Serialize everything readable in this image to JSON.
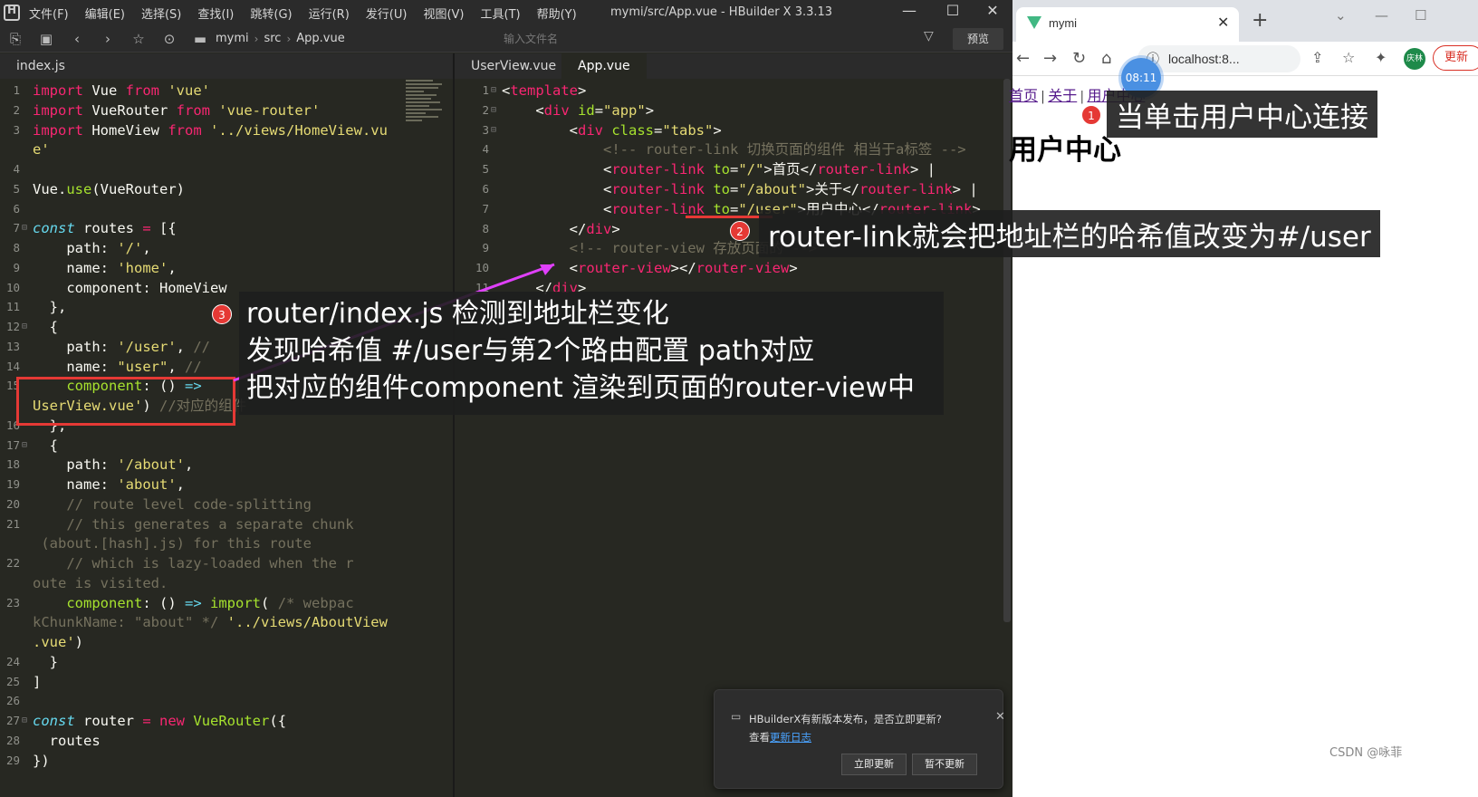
{
  "hbuilder": {
    "menu": [
      "文件(F)",
      "编辑(E)",
      "选择(S)",
      "查找(I)",
      "跳转(G)",
      "运行(R)",
      "发行(U)",
      "视图(V)",
      "工具(T)",
      "帮助(Y)"
    ],
    "title": "mymi/src/App.vue - HBuilder X 3.3.13",
    "breadcrumb": [
      "mymi",
      "src",
      "App.vue"
    ],
    "file_input_placeholder": "输入文件名",
    "preview_label": "预览",
    "left_tab": "index.js",
    "right_tabs": [
      "UserView.vue",
      "App.vue"
    ]
  },
  "left_code": [
    {
      "n": "1",
      "html": "<span class='kw'>import</span> Vue <span class='kw'>from</span> <span class='st'>'vue'</span>"
    },
    {
      "n": "2",
      "html": "<span class='kw'>import</span> VueRouter <span class='kw'>from</span> <span class='st'>'vue-router'</span>"
    },
    {
      "n": "3",
      "html": "<span class='kw'>import</span> HomeView <span class='kw'>from</span> <span class='st'>'../views/HomeView.vu</span>"
    },
    {
      "n": "",
      "html": "<span class='st'>e'</span>"
    },
    {
      "n": "4",
      "html": ""
    },
    {
      "n": "5",
      "html": "Vue.<span class='fn'>use</span>(VueRouter)"
    },
    {
      "n": "6",
      "html": ""
    },
    {
      "n": "7",
      "fold": true,
      "html": "<span class='it'>const</span> routes <span class='kw'>=</span> [{"
    },
    {
      "n": "8",
      "html": "    path: <span class='st'>'/'</span>,"
    },
    {
      "n": "9",
      "html": "    name: <span class='st'>'home'</span>,"
    },
    {
      "n": "10",
      "html": "    component: HomeView"
    },
    {
      "n": "11",
      "html": "  },"
    },
    {
      "n": "12",
      "fold": true,
      "html": "  {"
    },
    {
      "n": "13",
      "html": "    path: <span class='st'>'/user'</span>, <span class='cm'>//</span>"
    },
    {
      "n": "14",
      "html": "    name: <span class='st'>\"user\"</span>, <span class='cm'>//</span>"
    },
    {
      "n": "15",
      "html": "    <span class='fn'>component</span>: () <span class='it'>=&gt;</span>"
    },
    {
      "n": "",
      "html": "<span class='st'>UserView.vue'</span>) <span class='cm'>//对应的组件</span>"
    },
    {
      "n": "16",
      "html": "  },"
    },
    {
      "n": "17",
      "fold": true,
      "html": "  {"
    },
    {
      "n": "18",
      "html": "    path: <span class='st'>'/about'</span>,"
    },
    {
      "n": "19",
      "html": "    name: <span class='st'>'about'</span>,"
    },
    {
      "n": "20",
      "html": "    <span class='cm'>// route level code-splitting</span>"
    },
    {
      "n": "21",
      "html": "    <span class='cm'>// this generates a separate chunk</span>"
    },
    {
      "n": "",
      "html": "<span class='cm'> (about.[hash].js) for this route</span>"
    },
    {
      "n": "22",
      "html": "    <span class='cm'>// which is lazy-loaded when the r</span>"
    },
    {
      "n": "",
      "html": "<span class='cm'>oute is visited.</span>"
    },
    {
      "n": "23",
      "html": "    <span class='fn'>component</span>: () <span class='it'>=&gt;</span> <span class='fn'>import</span>( <span class='cm'>/* webpac</span>"
    },
    {
      "n": "",
      "html": "<span class='cm'>kChunkName: \"about\" */</span> <span class='st'>'../views/AboutView</span>"
    },
    {
      "n": "",
      "html": "<span class='st'>.vue'</span>)"
    },
    {
      "n": "24",
      "html": "  }"
    },
    {
      "n": "25",
      "html": "]"
    },
    {
      "n": "26",
      "html": ""
    },
    {
      "n": "27",
      "fold": true,
      "html": "<span class='it'>const</span> router <span class='kw'>=</span> <span class='kw'>new</span> <span class='fn'>VueRouter</span>({"
    },
    {
      "n": "28",
      "html": "  routes"
    },
    {
      "n": "29",
      "html": "})"
    }
  ],
  "right_code": [
    {
      "n": "1",
      "fold": true,
      "html": "<span class='tx'>&lt;</span><span class='tg'>template</span><span class='tx'>&gt;</span>"
    },
    {
      "n": "2",
      "fold": true,
      "html": "    &lt;<span class='tg'>div</span> <span class='at'>id</span>=<span class='st'>\"app\"</span>&gt;"
    },
    {
      "n": "3",
      "fold": true,
      "html": "        &lt;<span class='tg'>div</span> <span class='at'>class</span>=<span class='st'>\"tabs\"</span>&gt;"
    },
    {
      "n": "4",
      "html": "            <span class='cm'>&lt;!-- router-link 切换页面的组件 相当于a标签 --&gt;</span>"
    },
    {
      "n": "5",
      "html": "            &lt;<span class='tg'>router-link</span> <span class='at'>to</span>=<span class='st'>\"/\"</span>&gt;首页&lt;/<span class='tg'>router-link</span>&gt; |"
    },
    {
      "n": "6",
      "html": "            &lt;<span class='tg'>router-link</span> <span class='at'>to</span>=<span class='st'>\"/about\"</span>&gt;关于&lt;/<span class='tg'>router-link</span>&gt; |"
    },
    {
      "n": "7",
      "html": "            &lt;<span class='tg'>router-link</span> <span class='at'>to</span>=<span class='st'>\"/user\"</span>&gt;用户中心&lt;/<span class='tg'>router-link</span>&gt;"
    },
    {
      "n": "8",
      "html": "        &lt;/<span class='tg'>div</span>&gt;"
    },
    {
      "n": "9",
      "html": "        <span class='cm'>&lt;!-- router-view 存放页面的 --&gt;</span>"
    },
    {
      "n": "10",
      "html": "        &lt;<span class='tg'>router-view</span>&gt;&lt;/<span class='tg'>router-view</span>&gt;"
    },
    {
      "n": "11",
      "html": "    &lt;/<span class='tg'>div</span>&gt;"
    }
  ],
  "notification": {
    "message": "HBuilderX有新版本发布，是否立即更新?",
    "log_prefix": "查看",
    "log_link": "更新日志",
    "update_now": "立即更新",
    "later": "暂不更新"
  },
  "browser": {
    "tab_title": "mymi",
    "url": "localhost:8...",
    "avatar": "庆林",
    "update_label": "更新",
    "timer": "08:11",
    "nav_links": [
      "首页",
      "关于",
      "用户中心"
    ],
    "page_heading": "用户中心"
  },
  "annotations": {
    "badge1": "1",
    "badge2": "2",
    "badge3": "3",
    "note1": "当单击用户中心连接",
    "note2": "router-link就会把地址栏的哈希值改变为#/user",
    "note3_lines": [
      "router/index.js 检测到地址栏变化",
      "发现哈希值 #/user与第2个路由配置 path对应",
      "把对应的组件component 渲染到页面的router-view中"
    ]
  },
  "watermark": "CSDN @咏菲"
}
